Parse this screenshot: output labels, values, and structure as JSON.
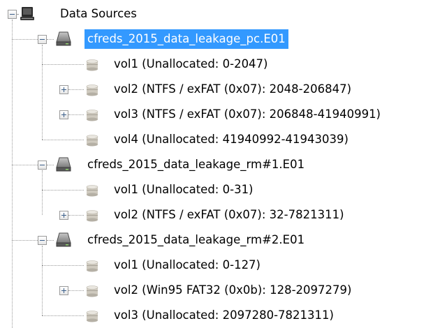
{
  "tree": {
    "root": {
      "label": "Data Sources",
      "icon": "monitor-icon",
      "expanded": true
    },
    "images": [
      {
        "label": "cfreds_2015_data_leakage_pc.E01",
        "icon": "hard-drive-icon",
        "expanded": true,
        "selected": true,
        "volumes": [
          {
            "label": "vol1 (Unallocated: 0-2047)",
            "expandable": false
          },
          {
            "label": "vol2 (NTFS / exFAT (0x07): 2048-206847)",
            "expandable": true
          },
          {
            "label": "vol3 (NTFS / exFAT (0x07): 206848-41940991)",
            "expandable": true
          },
          {
            "label": "vol4 (Unallocated: 41940992-41943039)",
            "expandable": false
          }
        ]
      },
      {
        "label": "cfreds_2015_data_leakage_rm#1.E01",
        "icon": "hard-drive-icon",
        "expanded": true,
        "selected": false,
        "volumes": [
          {
            "label": "vol1 (Unallocated: 0-31)",
            "expandable": false
          },
          {
            "label": "vol2 (NTFS / exFAT (0x07): 32-7821311)",
            "expandable": true
          }
        ]
      },
      {
        "label": "cfreds_2015_data_leakage_rm#2.E01",
        "icon": "hard-drive-icon",
        "expanded": true,
        "selected": false,
        "volumes": [
          {
            "label": "vol1 (Unallocated: 0-127)",
            "expandable": false
          },
          {
            "label": "vol2 (Win95 FAT32 (0x0b): 128-2097279)",
            "expandable": true
          },
          {
            "label": "vol3 (Unallocated: 2097280-7821311)",
            "expandable": false
          }
        ]
      }
    ],
    "volume_icon": "volume-icon",
    "colors": {
      "selection": "#3399ff",
      "selection_text": "#ffffff",
      "connector": "#9a9a9a"
    }
  }
}
